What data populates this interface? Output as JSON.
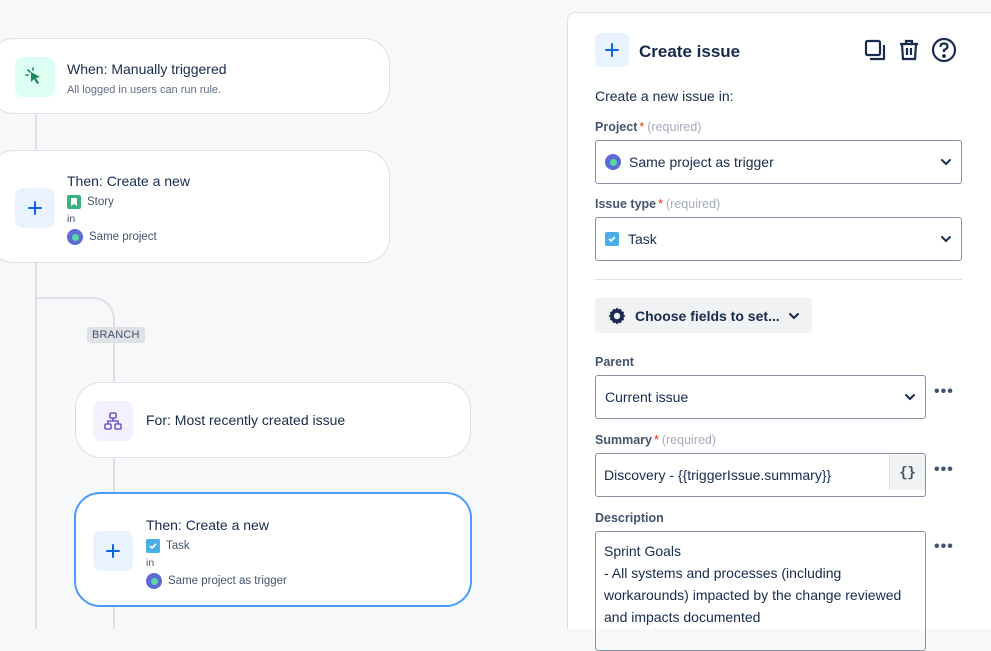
{
  "canvas": {
    "trigger": {
      "title": "When: Manually triggered",
      "subtitle": "All logged in users can run rule."
    },
    "action1": {
      "title": "Then: Create a new",
      "issue_type": "Story",
      "in_label": "in",
      "project": "Same project"
    },
    "branch_label": "BRANCH",
    "branch_for": {
      "title": "For: Most recently created issue"
    },
    "action2": {
      "title": "Then: Create a new",
      "issue_type": "Task",
      "in_label": "in",
      "project": "Same project as trigger"
    }
  },
  "panel": {
    "title": "Create issue",
    "intro": "Create a new issue in:",
    "project": {
      "label": "Project",
      "required_mark": "*",
      "hint": "(required)",
      "value": "Same project as trigger"
    },
    "issue_type": {
      "label": "Issue type",
      "required_mark": "*",
      "hint": "(required)",
      "value": "Task"
    },
    "choose_fields_label": "Choose fields to set...",
    "parent": {
      "label": "Parent",
      "value": "Current issue"
    },
    "summary": {
      "label": "Summary",
      "required_mark": "*",
      "hint": "(required)",
      "value": "Discovery - {{triggerIssue.summary}}",
      "smart_button": "{}"
    },
    "description": {
      "label": "Description",
      "value": "Sprint Goals\n- All systems and processes (including workarounds) impacted by the change reviewed and impacts documented"
    },
    "more_label": "•••"
  },
  "colors": {
    "accent": "#0c66e4",
    "selected_border": "#4c9aff",
    "trigger_icon_bg": "#dcfff1",
    "action_icon_bg": "#e9f2ff",
    "branch_icon_bg": "#f3f0ff"
  }
}
